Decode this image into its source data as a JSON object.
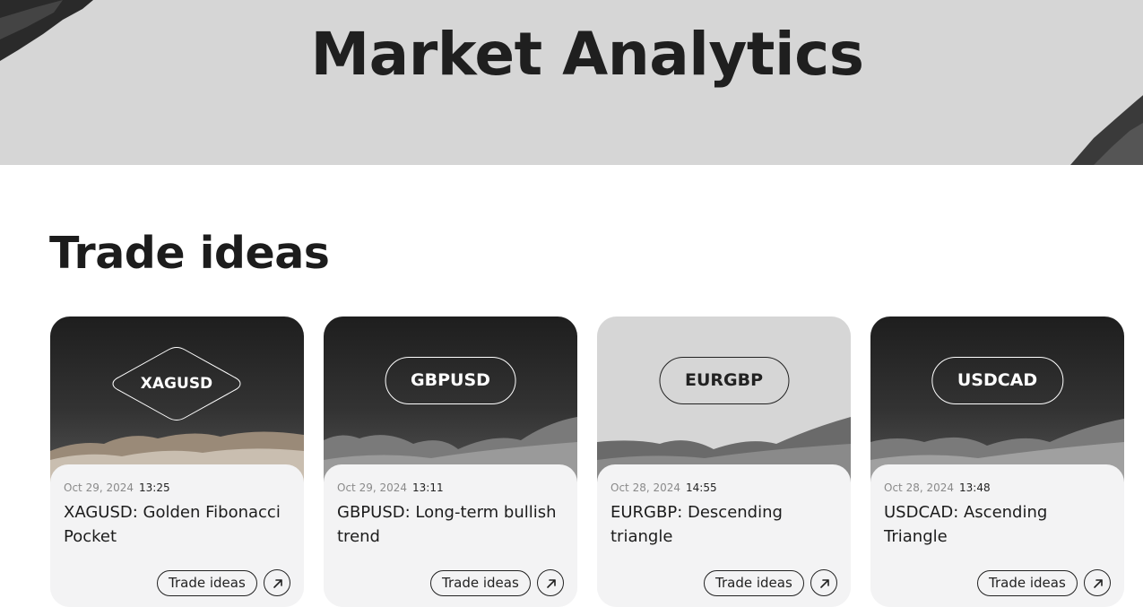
{
  "hero": {
    "title": "Market Analytics"
  },
  "section": {
    "title": "Trade ideas"
  },
  "cards": [
    {
      "symbol": "XAGUSD",
      "date": "Oct 29, 2024",
      "time": "13:25",
      "title": "XAGUSD: Golden Fibonacci Pocket",
      "tag": "Trade ideas",
      "theme": "dark",
      "badge_shape": "diamond"
    },
    {
      "symbol": "GBPUSD",
      "date": "Oct 29, 2024",
      "time": "13:11",
      "title": "GBPUSD: Long-term bullish trend",
      "tag": "Trade ideas",
      "theme": "dark",
      "badge_shape": "pill"
    },
    {
      "symbol": "EURGBP",
      "date": "Oct 28, 2024",
      "time": "14:55",
      "title": "EURGBP: Descending triangle",
      "tag": "Trade ideas",
      "theme": "light",
      "badge_shape": "pill"
    },
    {
      "symbol": "USDCAD",
      "date": "Oct 28, 2024",
      "time": "13:48",
      "title": "USDCAD: Ascending Triangle",
      "tag": "Trade ideas",
      "theme": "dark",
      "badge_shape": "pill"
    }
  ],
  "icons": {
    "open": "arrow-up-right-icon"
  },
  "colors": {
    "hero_bg": "#d6d6d6",
    "card_bg": "#f3f3f4",
    "text": "#1c1c1c"
  }
}
